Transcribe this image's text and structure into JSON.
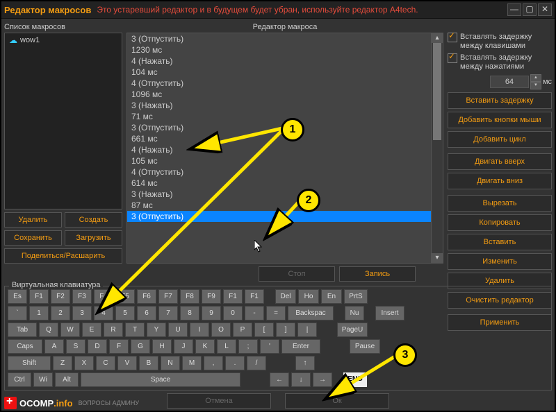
{
  "titlebar": {
    "title": "Редактор макросов",
    "warning": "Это устаревший редактор и в будущем будет убран, используйте редактор A4tech."
  },
  "labels": {
    "macrolist": "Список макросов",
    "editor": "Редактор макроса",
    "vkeyboard": "Виртуальная клавиатура",
    "ms": "мс"
  },
  "macros": [
    {
      "name": "wow1"
    }
  ],
  "leftbtns": {
    "delete": "Удалить",
    "create": "Создать",
    "save": "Сохранить",
    "load": "Загрузить",
    "share": "Поделиться/Расшарить"
  },
  "editor_lines": [
    "3 (Отпустить)",
    "1230 мс",
    "4 (Нажать)",
    "104 мс",
    "4 (Отпустить)",
    "1096 мс",
    "3 (Нажать)",
    "71 мс",
    "3 (Отпустить)",
    "661 мс",
    "4 (Нажать)",
    "105 мс",
    "4 (Отпустить)",
    "614 мс",
    "3 (Нажать)",
    "87 мс",
    "3 (Отпустить)"
  ],
  "editor_sel": 16,
  "rec": {
    "stop": "Стоп",
    "record": "Запись"
  },
  "right": {
    "chk1": "Вставлять задержку между клавишами",
    "chk2": "Вставлять задержку между нажатиями",
    "delay": "64",
    "insert_delay": "Вставить задержку",
    "add_mouse": "Добавить кнопки мыши",
    "add_loop": "Добавить цикл",
    "move_up": "Двигать вверх",
    "move_down": "Двигать вниз",
    "cut": "Вырезать",
    "copy": "Копировать",
    "paste": "Вставить",
    "edit": "Изменить",
    "del": "Удалить",
    "clear": "Очистить редактор",
    "apply": "Применить"
  },
  "kb": {
    "r1": [
      "Es",
      "F1",
      "F2",
      "F3",
      "F4",
      "F5",
      "F6",
      "F7",
      "F8",
      "F9",
      "F1",
      "F1",
      "",
      "Del",
      "Ho",
      "En",
      "PrtS"
    ],
    "r2": [
      "`",
      "1",
      "2",
      "3",
      "4",
      "5",
      "6",
      "7",
      "8",
      "9",
      "0",
      "-",
      "=",
      "Backspac",
      "",
      "Nu",
      "",
      "Insert"
    ],
    "r3": [
      "Tab",
      "Q",
      "W",
      "E",
      "R",
      "T",
      "Y",
      "U",
      "I",
      "O",
      "P",
      "[",
      "]",
      "|",
      "",
      "",
      "PageU",
      ""
    ],
    "r4": [
      "Caps",
      "A",
      "S",
      "D",
      "F",
      "G",
      "H",
      "J",
      "K",
      "L",
      ";",
      "'",
      "Enter",
      "",
      "",
      "",
      "Pause"
    ],
    "r5": [
      "Shift",
      "Z",
      "X",
      "C",
      "V",
      "B",
      "N",
      "M",
      ",",
      ".",
      "/",
      "",
      "",
      "",
      "↑",
      ""
    ],
    "r6": [
      "Ctrl",
      "Wi",
      "Alt",
      "Space",
      "",
      "",
      "",
      "←",
      "↓",
      "→",
      "",
      "ENG"
    ]
  },
  "bottom": {
    "cancel": "Отмена",
    "ok": "Ок"
  },
  "brand": {
    "name": "OCOMP",
    "suffix": ".info",
    "tag": "ВОПРОСЫ АДМИНУ"
  },
  "callouts": {
    "c1": "1",
    "c2": "2",
    "c3": "3"
  }
}
